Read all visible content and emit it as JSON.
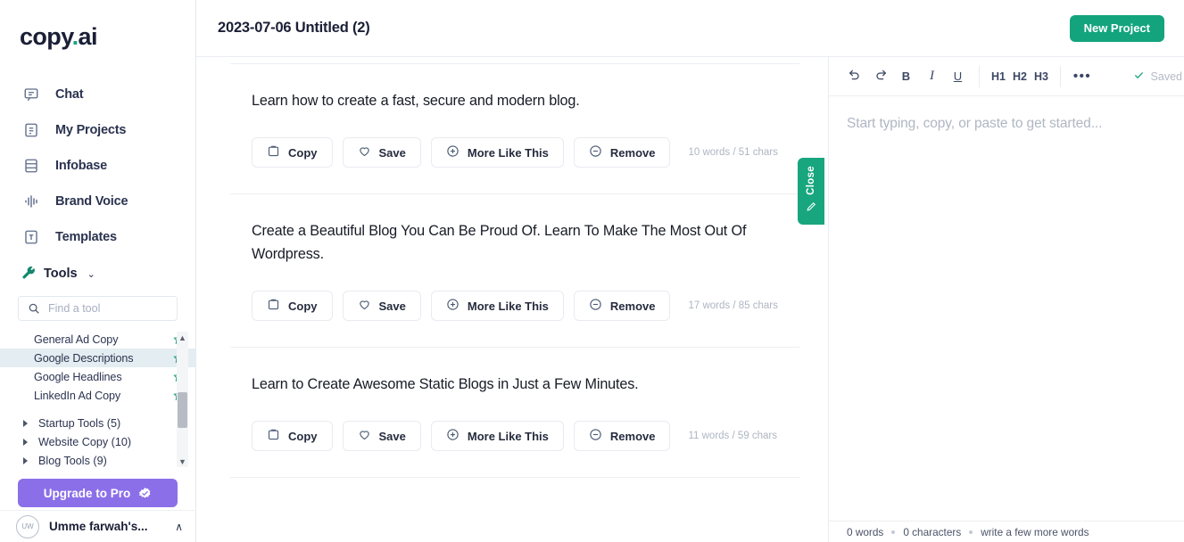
{
  "brand": {
    "name": "copy",
    "dot": ".",
    "suffix": "ai"
  },
  "sidebar": {
    "nav": [
      {
        "label": "Chat",
        "icon": "chat-icon"
      },
      {
        "label": "My Projects",
        "icon": "document-icon"
      },
      {
        "label": "Infobase",
        "icon": "database-icon"
      },
      {
        "label": "Brand Voice",
        "icon": "waveform-icon"
      },
      {
        "label": "Templates",
        "icon": "template-icon"
      }
    ],
    "tools_section": {
      "label": "Tools",
      "chevron": "⌄"
    },
    "search": {
      "placeholder": "Find a tool",
      "value": ""
    },
    "tool_items": [
      {
        "label": "General Ad Copy",
        "selected": false
      },
      {
        "label": "Google Descriptions",
        "selected": true
      },
      {
        "label": "Google Headlines",
        "selected": false
      },
      {
        "label": "LinkedIn Ad Copy",
        "selected": false
      }
    ],
    "tool_groups": [
      {
        "label": "Startup Tools (5)"
      },
      {
        "label": "Website Copy (10)"
      },
      {
        "label": "Blog Tools (9)"
      }
    ],
    "upgrade": {
      "label": "Upgrade to Pro",
      "color": "#8b6fe8"
    },
    "account": {
      "name": "Umme farwah's...",
      "initials": "UW",
      "caret": "∧"
    }
  },
  "header": {
    "title": "2023-07-06 Untitled (2)",
    "new_project_label": "New Project",
    "new_project_color": "#13a47e"
  },
  "results": {
    "action_labels": {
      "copy": "Copy",
      "save": "Save",
      "more": "More Like This",
      "remove": "Remove"
    },
    "cards": [
      {
        "text": "Learn how to create a fast, secure and modern blog.",
        "meta": "10 words / 51 chars"
      },
      {
        "text": "Create a Beautiful Blog You Can Be Proud Of. Learn To Make The Most Out Of Wordpress.",
        "meta": "17 words / 85 chars"
      },
      {
        "text": "Learn to Create Awesome Static Blogs in Just a Few Minutes.",
        "meta": "11 words / 59 chars"
      }
    ]
  },
  "close_tab": {
    "label": "Close",
    "color": "#17a67e"
  },
  "editor": {
    "toolbar": {
      "undo": "undo-icon",
      "redo": "redo-icon",
      "bold": "B",
      "italic": "I",
      "underline": "U",
      "h1": "H1",
      "h2": "H2",
      "h3": "H3",
      "more": "•••",
      "saved_label": "Saved"
    },
    "placeholder": "Start typing, copy, or paste to get started...",
    "status": {
      "words": "0 words",
      "characters": "0 characters",
      "hint": "write a few more words"
    }
  }
}
